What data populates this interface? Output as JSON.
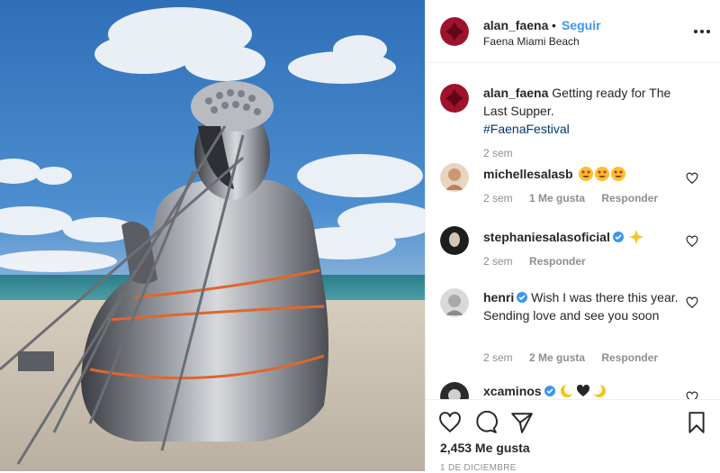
{
  "header": {
    "username": "alan_faena",
    "separator": "•",
    "follow_label": "Seguir",
    "location": "Faena Miami Beach"
  },
  "caption": {
    "username": "alan_faena",
    "text": "Getting ready for The Last Supper.",
    "hashtag": "#FaenaFestival",
    "time": "2 sem"
  },
  "comments": [
    {
      "username": "michellesalasb",
      "text": "",
      "time": "2 sem",
      "likes": "1 Me gusta",
      "reply": "Responder",
      "emojis": [
        "heart-eyes-emoji",
        "heart-eyes-emoji",
        "heart-eyes-emoji"
      ]
    },
    {
      "username": "stephaniesalasoficial",
      "text": "",
      "time": "2 sem",
      "likes": "",
      "reply": "Responder",
      "emojis": [
        "sparkle-emoji"
      ]
    },
    {
      "username": "henri",
      "text": "Wish I was there this year. Sending love and see you soon",
      "time": "2 sem",
      "likes": "2 Me gusta",
      "reply": "Responder"
    },
    {
      "username": "xcaminos",
      "text": "",
      "emojis": [
        "moon-emoji",
        "heart-emoji",
        "moon-emoji"
      ]
    }
  ],
  "footer": {
    "likes": "2,453 Me gusta",
    "date": "1 DE DICIEMBRE"
  },
  "icons": [
    "heart-icon",
    "comment-icon",
    "share-icon",
    "bookmark-icon",
    "more-icon",
    "verified-icon"
  ],
  "colors": {
    "link": "#3897f0",
    "verified": "#3897f0",
    "muted": "#8e8e8e",
    "text": "#262626"
  }
}
